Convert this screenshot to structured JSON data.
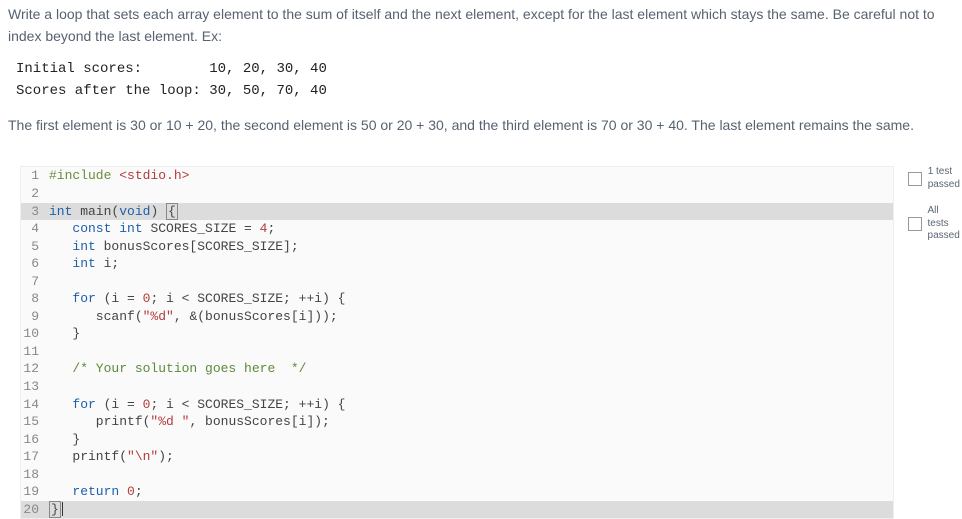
{
  "prompt": {
    "p1": "Write a loop that sets each array element to the sum of itself and the next element, except for the last element which stays the same. Be careful not to index beyond the last element. Ex:",
    "mono1": "Initial scores:        10, 20, 30, 40",
    "mono2": "Scores after the loop: 30, 50, 70, 40",
    "p2": "The first element is 30 or 10 + 20, the second element is 50 or 20 + 30, and the third element is 70 or 30 + 40. The last element remains the same."
  },
  "code": {
    "lines": [
      {
        "n": "1",
        "segments": [
          {
            "t": "#include ",
            "c": "tok-pre"
          },
          {
            "t": "<stdio.h>",
            "c": "tok-inc"
          }
        ]
      },
      {
        "n": "2",
        "segments": []
      },
      {
        "n": "3",
        "segments": [
          {
            "t": "int",
            "c": "tok-type"
          },
          {
            "t": " main(",
            "c": ""
          },
          {
            "t": "void",
            "c": "tok-kw"
          },
          {
            "t": ") ",
            "c": ""
          },
          {
            "t": "{",
            "c": "tok-bracket",
            "bracket": true
          }
        ],
        "current": true
      },
      {
        "n": "4",
        "segments": [
          {
            "t": "   ",
            "c": ""
          },
          {
            "t": "const",
            "c": "tok-kw"
          },
          {
            "t": " ",
            "c": ""
          },
          {
            "t": "int",
            "c": "tok-type"
          },
          {
            "t": " SCORES_SIZE = ",
            "c": ""
          },
          {
            "t": "4",
            "c": "tok-num"
          },
          {
            "t": ";",
            "c": ""
          }
        ]
      },
      {
        "n": "5",
        "segments": [
          {
            "t": "   ",
            "c": ""
          },
          {
            "t": "int",
            "c": "tok-type"
          },
          {
            "t": " bonusScores[SCORES_SIZE];",
            "c": ""
          }
        ]
      },
      {
        "n": "6",
        "segments": [
          {
            "t": "   ",
            "c": ""
          },
          {
            "t": "int",
            "c": "tok-type"
          },
          {
            "t": " i;",
            "c": ""
          }
        ]
      },
      {
        "n": "7",
        "segments": []
      },
      {
        "n": "8",
        "segments": [
          {
            "t": "   ",
            "c": ""
          },
          {
            "t": "for",
            "c": "tok-kw"
          },
          {
            "t": " (i = ",
            "c": ""
          },
          {
            "t": "0",
            "c": "tok-num"
          },
          {
            "t": "; i < SCORES_SIZE; ++i) {",
            "c": ""
          }
        ]
      },
      {
        "n": "9",
        "segments": [
          {
            "t": "      scanf(",
            "c": ""
          },
          {
            "t": "\"%d\"",
            "c": "tok-str"
          },
          {
            "t": ", &(bonusScores[i]));",
            "c": ""
          }
        ]
      },
      {
        "n": "10",
        "segments": [
          {
            "t": "   }",
            "c": ""
          }
        ]
      },
      {
        "n": "11",
        "segments": []
      },
      {
        "n": "12",
        "segments": [
          {
            "t": "   ",
            "c": ""
          },
          {
            "t": "/* Your solution goes here  */",
            "c": "tok-cmt"
          }
        ]
      },
      {
        "n": "13",
        "segments": []
      },
      {
        "n": "14",
        "segments": [
          {
            "t": "   ",
            "c": ""
          },
          {
            "t": "for",
            "c": "tok-kw"
          },
          {
            "t": " (i = ",
            "c": ""
          },
          {
            "t": "0",
            "c": "tok-num"
          },
          {
            "t": "; i < SCORES_SIZE; ++i) {",
            "c": ""
          }
        ]
      },
      {
        "n": "15",
        "segments": [
          {
            "t": "      printf(",
            "c": ""
          },
          {
            "t": "\"%d \"",
            "c": "tok-str"
          },
          {
            "t": ", bonusScores[i]);",
            "c": ""
          }
        ]
      },
      {
        "n": "16",
        "segments": [
          {
            "t": "   }",
            "c": ""
          }
        ]
      },
      {
        "n": "17",
        "segments": [
          {
            "t": "   printf(",
            "c": ""
          },
          {
            "t": "\"\\n\"",
            "c": "tok-str"
          },
          {
            "t": ");",
            "c": ""
          }
        ]
      },
      {
        "n": "18",
        "segments": []
      },
      {
        "n": "19",
        "segments": [
          {
            "t": "   ",
            "c": ""
          },
          {
            "t": "return",
            "c": "tok-kw"
          },
          {
            "t": " ",
            "c": ""
          },
          {
            "t": "0",
            "c": "tok-num"
          },
          {
            "t": ";",
            "c": ""
          }
        ]
      },
      {
        "n": "20",
        "segments": [
          {
            "t": "}",
            "c": "tok-bracket",
            "bracket": true
          }
        ],
        "current": true,
        "cursor": true
      }
    ]
  },
  "sidebar": {
    "tests": [
      {
        "label": "1 test\npassed",
        "checked": false
      },
      {
        "label": "All tests\npassed",
        "checked": false
      }
    ]
  }
}
